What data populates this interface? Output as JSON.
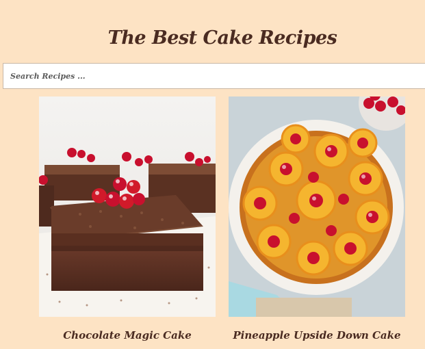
{
  "page": {
    "title": "The Best Cake Recipes"
  },
  "search": {
    "placeholder": "Search Recipes ...",
    "value": ""
  },
  "recipes": [
    {
      "title": "Chocolate Magic Cake",
      "image": "chocolate-magic-cake-photo"
    },
    {
      "title": "Pineapple Upside Down Cake",
      "image": "pineapple-upside-down-cake-photo"
    }
  ],
  "colors": {
    "background": "#fde3c4",
    "title_text": "#4a2b21",
    "search_background": "#ffffff"
  }
}
